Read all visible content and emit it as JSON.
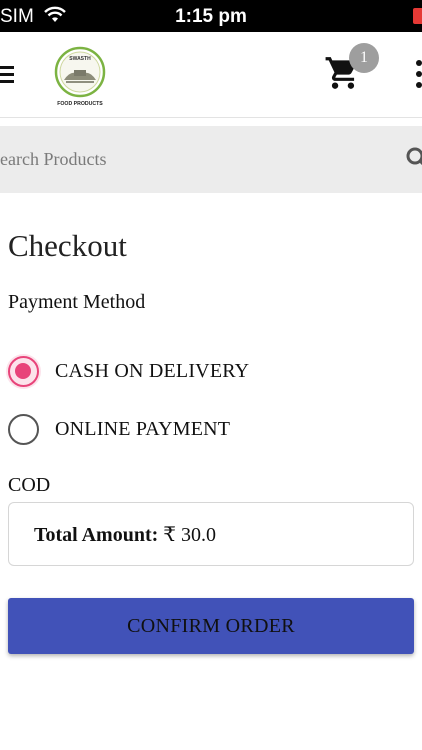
{
  "status_bar": {
    "carrier": "SIM",
    "time": "1:15 pm",
    "wifi_icon": "wifi-icon",
    "battery_icon": "battery-low-icon",
    "battery_color": "#e53935"
  },
  "header": {
    "menu_icon": "hamburger-menu-icon",
    "logo": {
      "top_text": "SWASTH",
      "bottom_text": "FOOD PRODUCTS",
      "ring_color": "#7cb342"
    },
    "cart": {
      "icon": "shopping-cart-icon",
      "badge_count": "1",
      "badge_color": "#9e9e9e"
    },
    "more_icon": "vertical-ellipsis-icon"
  },
  "search": {
    "placeholder": "Search Products",
    "icon": "search-icon"
  },
  "checkout": {
    "title": "Checkout",
    "payment_method_label": "Payment Method",
    "options": [
      {
        "label": "CASH ON DELIVERY",
        "selected": true
      },
      {
        "label": "ONLINE PAYMENT",
        "selected": false
      }
    ],
    "selected_code": "COD",
    "total": {
      "label": "Total Amount:",
      "value": "₹ 30.0"
    },
    "confirm_label": "CONFIRM ORDER"
  },
  "colors": {
    "accent_radio": "#e8447a",
    "button_background": "#4152b8",
    "search_background": "#ececec"
  }
}
